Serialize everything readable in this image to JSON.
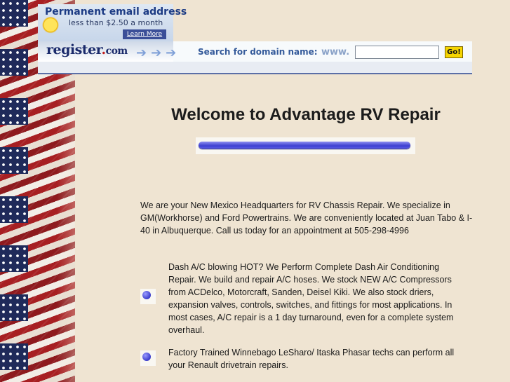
{
  "ad": {
    "headline": "Permanent email address",
    "subline": "less than $2.50 a month",
    "learn_more": "Learn More",
    "logo_main": "register",
    "logo_dot": ".",
    "logo_com": "com",
    "search_label": "Search for domain name:",
    "www_prefix": "www.",
    "domain_value": "",
    "go_label": "Go!"
  },
  "page": {
    "title": "Welcome to Advantage RV Repair",
    "intro": "We are your New Mexico Headquarters for RV Chassis Repair. We specialize in GM(Workhorse) and Ford Powertrains. We are conveniently located at Juan Tabo & I-40 in Albuquerque. Call us today for an appointment at 505-298-4996",
    "services": [
      {
        "text": "Dash A/C blowing HOT? We Perform Complete Dash Air Conditioning Repair. We build and repair A/C hoses. We stock NEW A/C Compressors from ACDelco, Motorcraft, Sanden, Deisel Kiki. We also stock driers, expansion valves, controls, switches, and fittings for most applications. In most cases, A/C repair is a 1 day turnaround, even for a complete system overhaul."
      },
      {
        "text": "Factory Trained Winnebago LeSharo/ Itaska Phasar techs can perform all your Renault drivetrain repairs."
      }
    ]
  },
  "colors": {
    "background": "#efe4d2",
    "ad_blue": "#1c3b84",
    "bullet_blue": "#3a3ccc",
    "go_yellow": "#f6d500"
  },
  "icons": [
    "flag-border",
    "sun-hand-icon",
    "arrow-icon",
    "bullet-icon",
    "horizontal-rule"
  ]
}
